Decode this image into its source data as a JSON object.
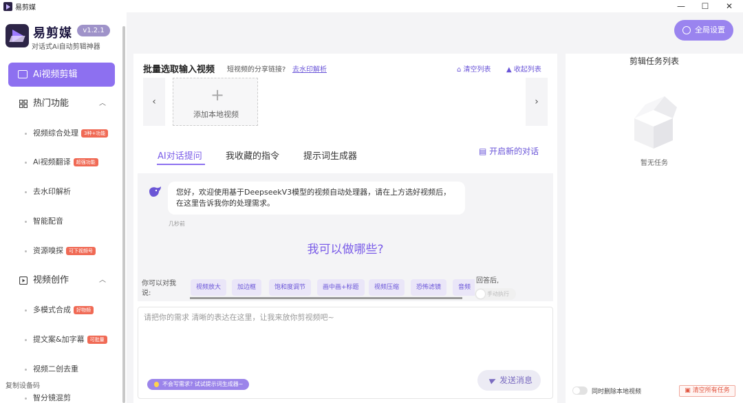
{
  "window": {
    "title": "易剪媒",
    "minimize": "—",
    "maximize": "☐",
    "close": "✕"
  },
  "brand": {
    "name": "易剪媒",
    "version": "v1.2.1",
    "tagline": "对话式Ai自动剪辑神器"
  },
  "sidebar": {
    "primary": "Ai视频剪辑",
    "groups": [
      {
        "label": "热门功能",
        "items": [
          {
            "label": "视频综合处理",
            "tag": "3种+功能"
          },
          {
            "label": "Ai视频翻译",
            "tag": "超强功能"
          },
          {
            "label": "去水印解析",
            "tag": ""
          },
          {
            "label": "智能配音",
            "tag": ""
          },
          {
            "label": "资源嗅探",
            "tag": "可下视频号"
          }
        ]
      },
      {
        "label": "视频创作",
        "items": [
          {
            "label": "多模式合成",
            "tag": "好物频"
          },
          {
            "label": "提文案&加字幕",
            "tag": "可批量"
          },
          {
            "label": "视频二创去重",
            "tag": ""
          },
          {
            "label": "智分镜混剪",
            "tag": ""
          }
        ]
      }
    ],
    "copy_device": "复制设备码"
  },
  "header": {
    "global_settings": "全局设置"
  },
  "batch": {
    "title": "批量选取输入视频",
    "hint": "短视频的分享链接?",
    "link": "去水印解析",
    "clear": "清空列表",
    "collapse": "收起列表",
    "add_local": "添加本地视频",
    "prev": "‹",
    "next": "›"
  },
  "tabs": [
    {
      "label": "AI对话提问",
      "active": true
    },
    {
      "label": "我收藏的指令",
      "active": false
    },
    {
      "label": "提示词生成器",
      "active": false
    }
  ],
  "new_chat": "开启新的对话",
  "chat": {
    "message": "您好，欢迎使用基于DeepseekV3模型的视频自动处理器，请在上方选好视频后，在这里告诉我你的处理需求。",
    "time": "几秒前",
    "what_title": "我可以做哪些?"
  },
  "quick": {
    "label": "你可以对我说:",
    "chips": [
      "视频放大",
      "加边框",
      "饱和度调节",
      "画中画+标题",
      "视频压缩",
      "恐怖滤镜",
      "音频提"
    ],
    "answer_after": "回答后,",
    "auto_exec": "手动执行"
  },
  "input": {
    "placeholder": "请把你的需求 清晰的表达在这里，让我来放你剪视频吧~",
    "prompt_hint": "不会写需求? 试试提示词生成器~",
    "send": "发送消息"
  },
  "tasks": {
    "title": "剪辑任务列表",
    "empty": "暂无任务",
    "delete_local": "同时删除本地视频",
    "clear_all": "清空所有任务"
  }
}
